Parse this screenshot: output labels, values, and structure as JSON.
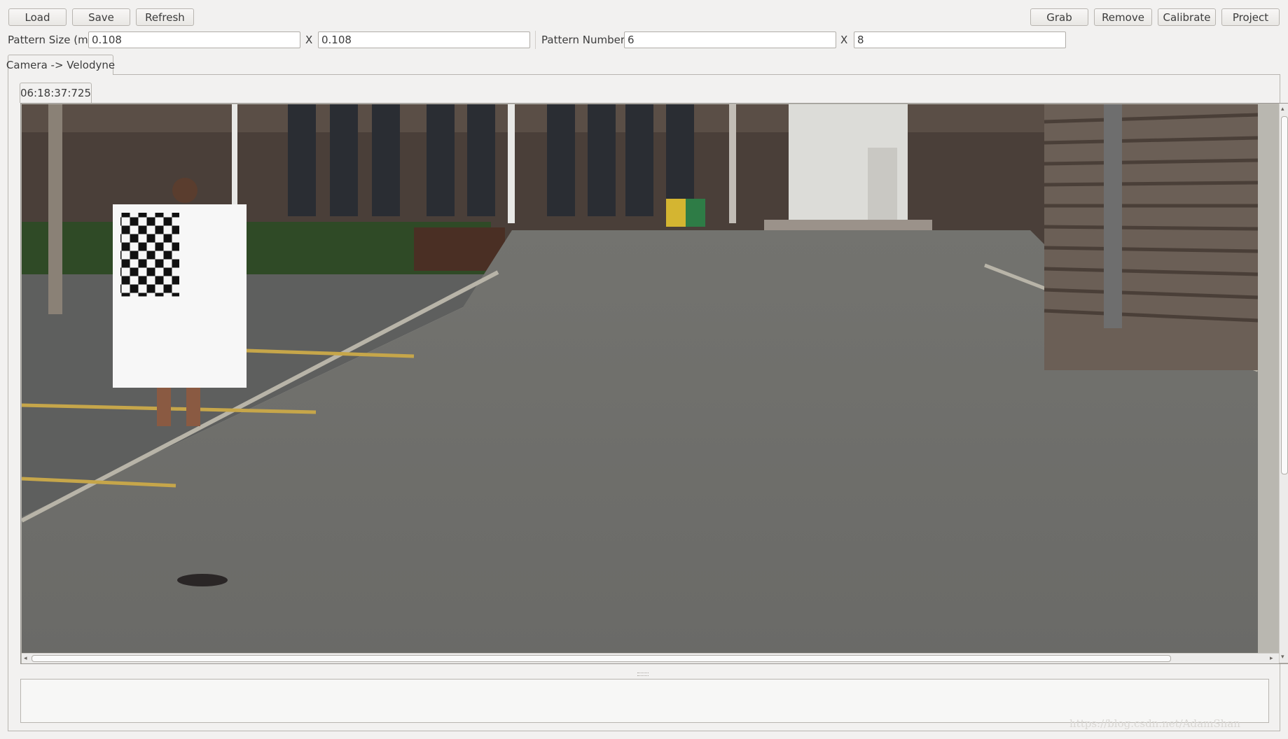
{
  "toolbar": {
    "load_label": "Load",
    "save_label": "Save",
    "refresh_label": "Refresh",
    "grab_label": "Grab",
    "remove_label": "Remove",
    "calibrate_label": "Calibrate",
    "project_label": "Project"
  },
  "pattern": {
    "size_label": "Pattern Size (m)",
    "size_w": "0.108",
    "size_h": "0.108",
    "size_sep": "X",
    "number_label": "Pattern Number",
    "number_w": "6",
    "number_h": "8",
    "number_sep": "X"
  },
  "tabs": {
    "main_tab": "Camera -> Velodyne",
    "frame_tab": "06:18:37:725"
  },
  "log": {
    "text": ""
  },
  "watermark": "https://blog.csdn.net/AdamShan"
}
